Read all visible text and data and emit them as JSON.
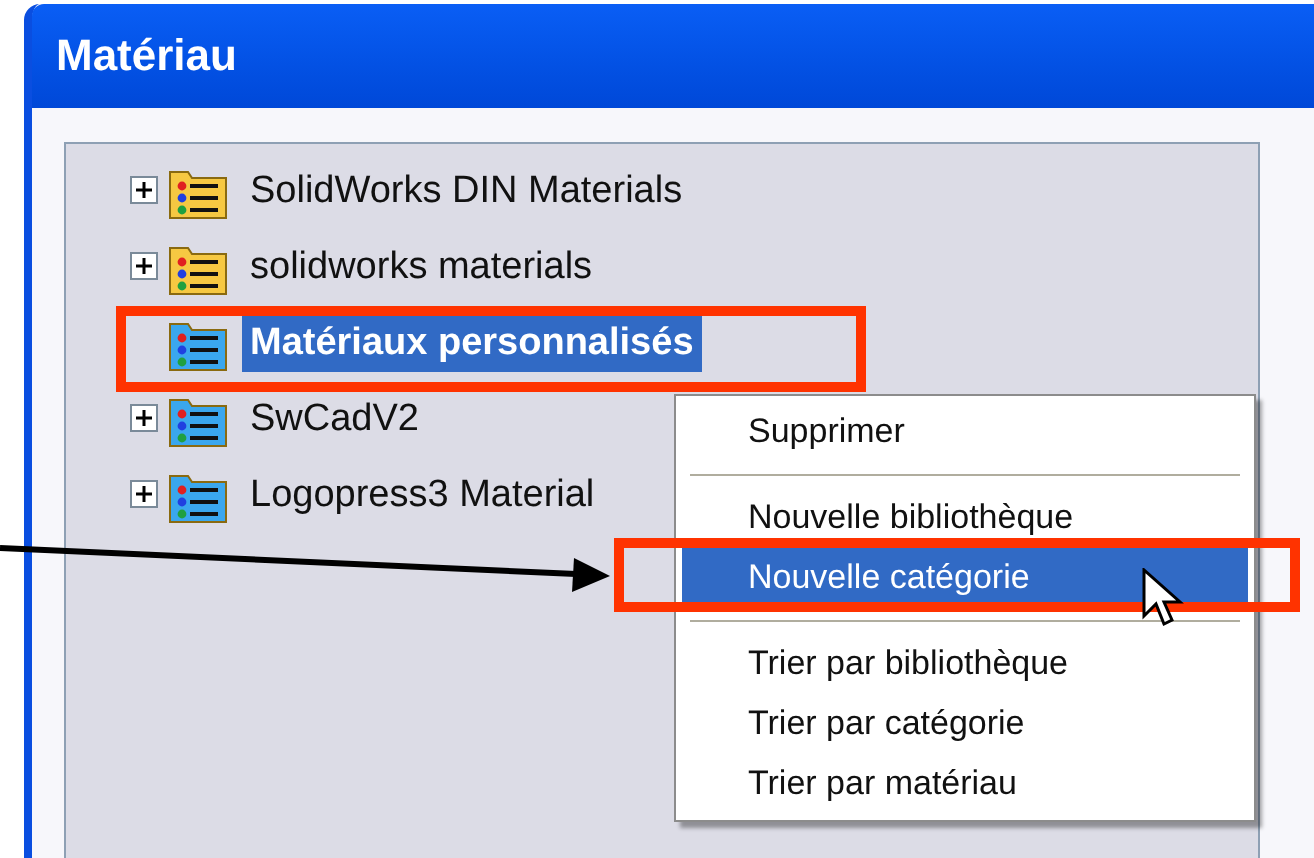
{
  "window": {
    "title": "Matériau"
  },
  "tree": {
    "items": [
      {
        "label": "SolidWorks DIN Materials",
        "kind": "library",
        "expandable": true,
        "selected": false
      },
      {
        "label": "solidworks materials",
        "kind": "library",
        "expandable": true,
        "selected": false
      },
      {
        "label": "Matériaux personnalisés",
        "kind": "category",
        "expandable": false,
        "selected": true
      },
      {
        "label": "SwCadV2",
        "kind": "category",
        "expandable": true,
        "selected": false
      },
      {
        "label": "Logopress3 Material",
        "kind": "category",
        "expandable": true,
        "selected": false
      }
    ]
  },
  "context_menu": {
    "items": [
      {
        "kind": "item",
        "label": "Supprimer",
        "selected": false
      },
      {
        "kind": "separator"
      },
      {
        "kind": "item",
        "label": "Nouvelle bibliothèque",
        "selected": false
      },
      {
        "kind": "item",
        "label": "Nouvelle catégorie",
        "selected": true
      },
      {
        "kind": "separator"
      },
      {
        "kind": "item",
        "label": "Trier par bibliothèque",
        "selected": false
      },
      {
        "kind": "item",
        "label": "Trier par catégorie",
        "selected": false
      },
      {
        "kind": "item",
        "label": "Trier par matériau",
        "selected": false
      }
    ]
  }
}
